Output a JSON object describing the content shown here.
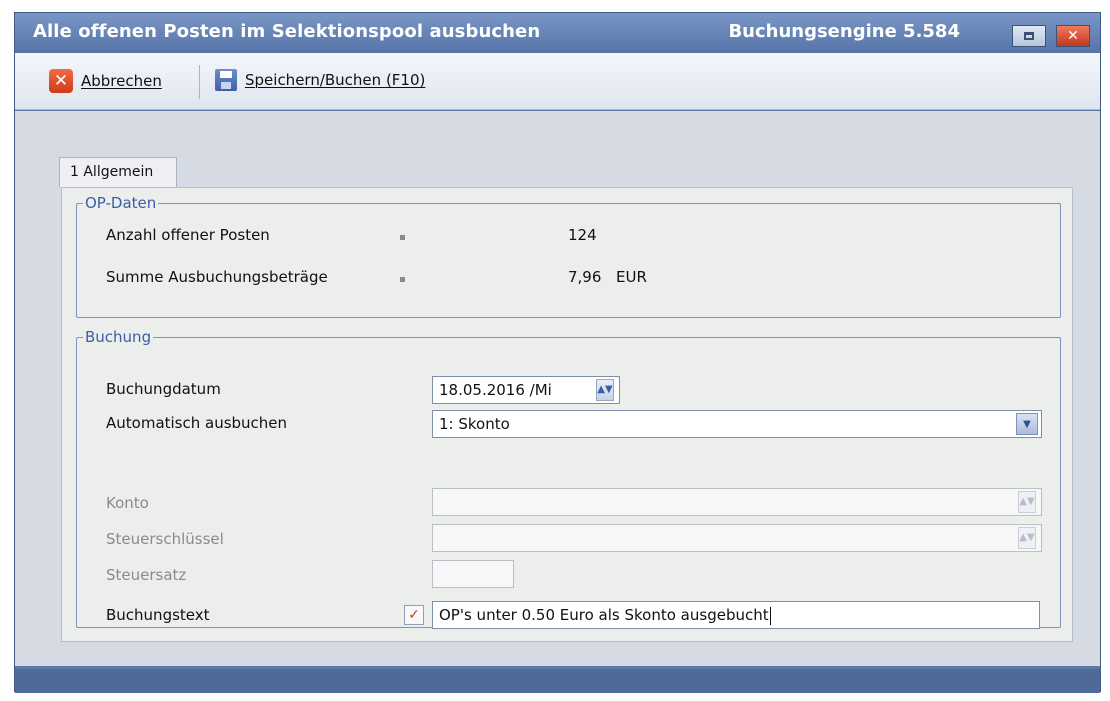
{
  "window": {
    "title": "Alle offenen Posten im Selektionspool ausbuchen",
    "engine": "Buchungsengine 5.584"
  },
  "toolbar": {
    "cancel_label": "Abbrechen",
    "save_label": "Speichern/Buchen (F10)"
  },
  "tabs": [
    {
      "label": "1 Allgemein"
    }
  ],
  "op_daten": {
    "legend": "OP-Daten",
    "anzahl_label": "Anzahl offener Posten",
    "anzahl_value": "124",
    "summe_label": "Summe Ausbuchungsbeträge",
    "summe_value": "7,96",
    "summe_currency": "EUR"
  },
  "buchung": {
    "legend": "Buchung",
    "datum_label": "Buchungdatum",
    "datum_value": "18.05.2016 /Mi",
    "auto_label": "Automatisch ausbuchen",
    "auto_value": "1: Skonto",
    "konto_label": "Konto",
    "konto_value": "",
    "steuerschluessel_label": "Steuerschlüssel",
    "steuerschluessel_value": "",
    "steuersatz_label": "Steuersatz",
    "steuersatz_value": "",
    "text_label": "Buchungstext",
    "text_value": "OP's unter 0.50 Euro als Skonto ausgebucht"
  },
  "icons": {
    "cancel": "close-icon",
    "save": "save-icon",
    "text": "checkmark-icon"
  }
}
